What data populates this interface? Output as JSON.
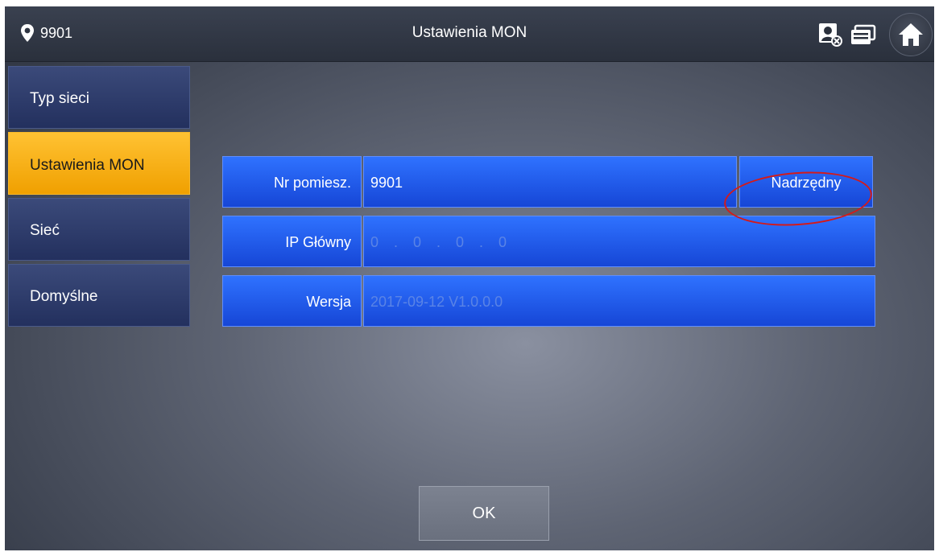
{
  "header": {
    "room_number": "9901",
    "title": "Ustawienia MON",
    "icons": [
      "location-pin-icon",
      "user-status-icon",
      "message-icon",
      "home-icon"
    ]
  },
  "sidebar": {
    "items": [
      {
        "label": "Typ sieci",
        "active": false
      },
      {
        "label": "Ustawienia MON",
        "active": true
      },
      {
        "label": "Sieć",
        "active": false
      },
      {
        "label": "Domyślne",
        "active": false
      }
    ]
  },
  "form": {
    "room": {
      "label": "Nr pomiesz.",
      "value": "9901",
      "mode_button": "Nadrzędny"
    },
    "master_ip": {
      "label": "IP Główny",
      "value": "0 . 0 . 0 . 0"
    },
    "version": {
      "label": "Wersja",
      "value": "2017-09-12 V1.0.0.0"
    }
  },
  "footer": {
    "ok_label": "OK"
  },
  "colors": {
    "accent": "#f0a000",
    "field_blue": "#1f5cf0",
    "highlight_ring": "#d41a1a"
  }
}
